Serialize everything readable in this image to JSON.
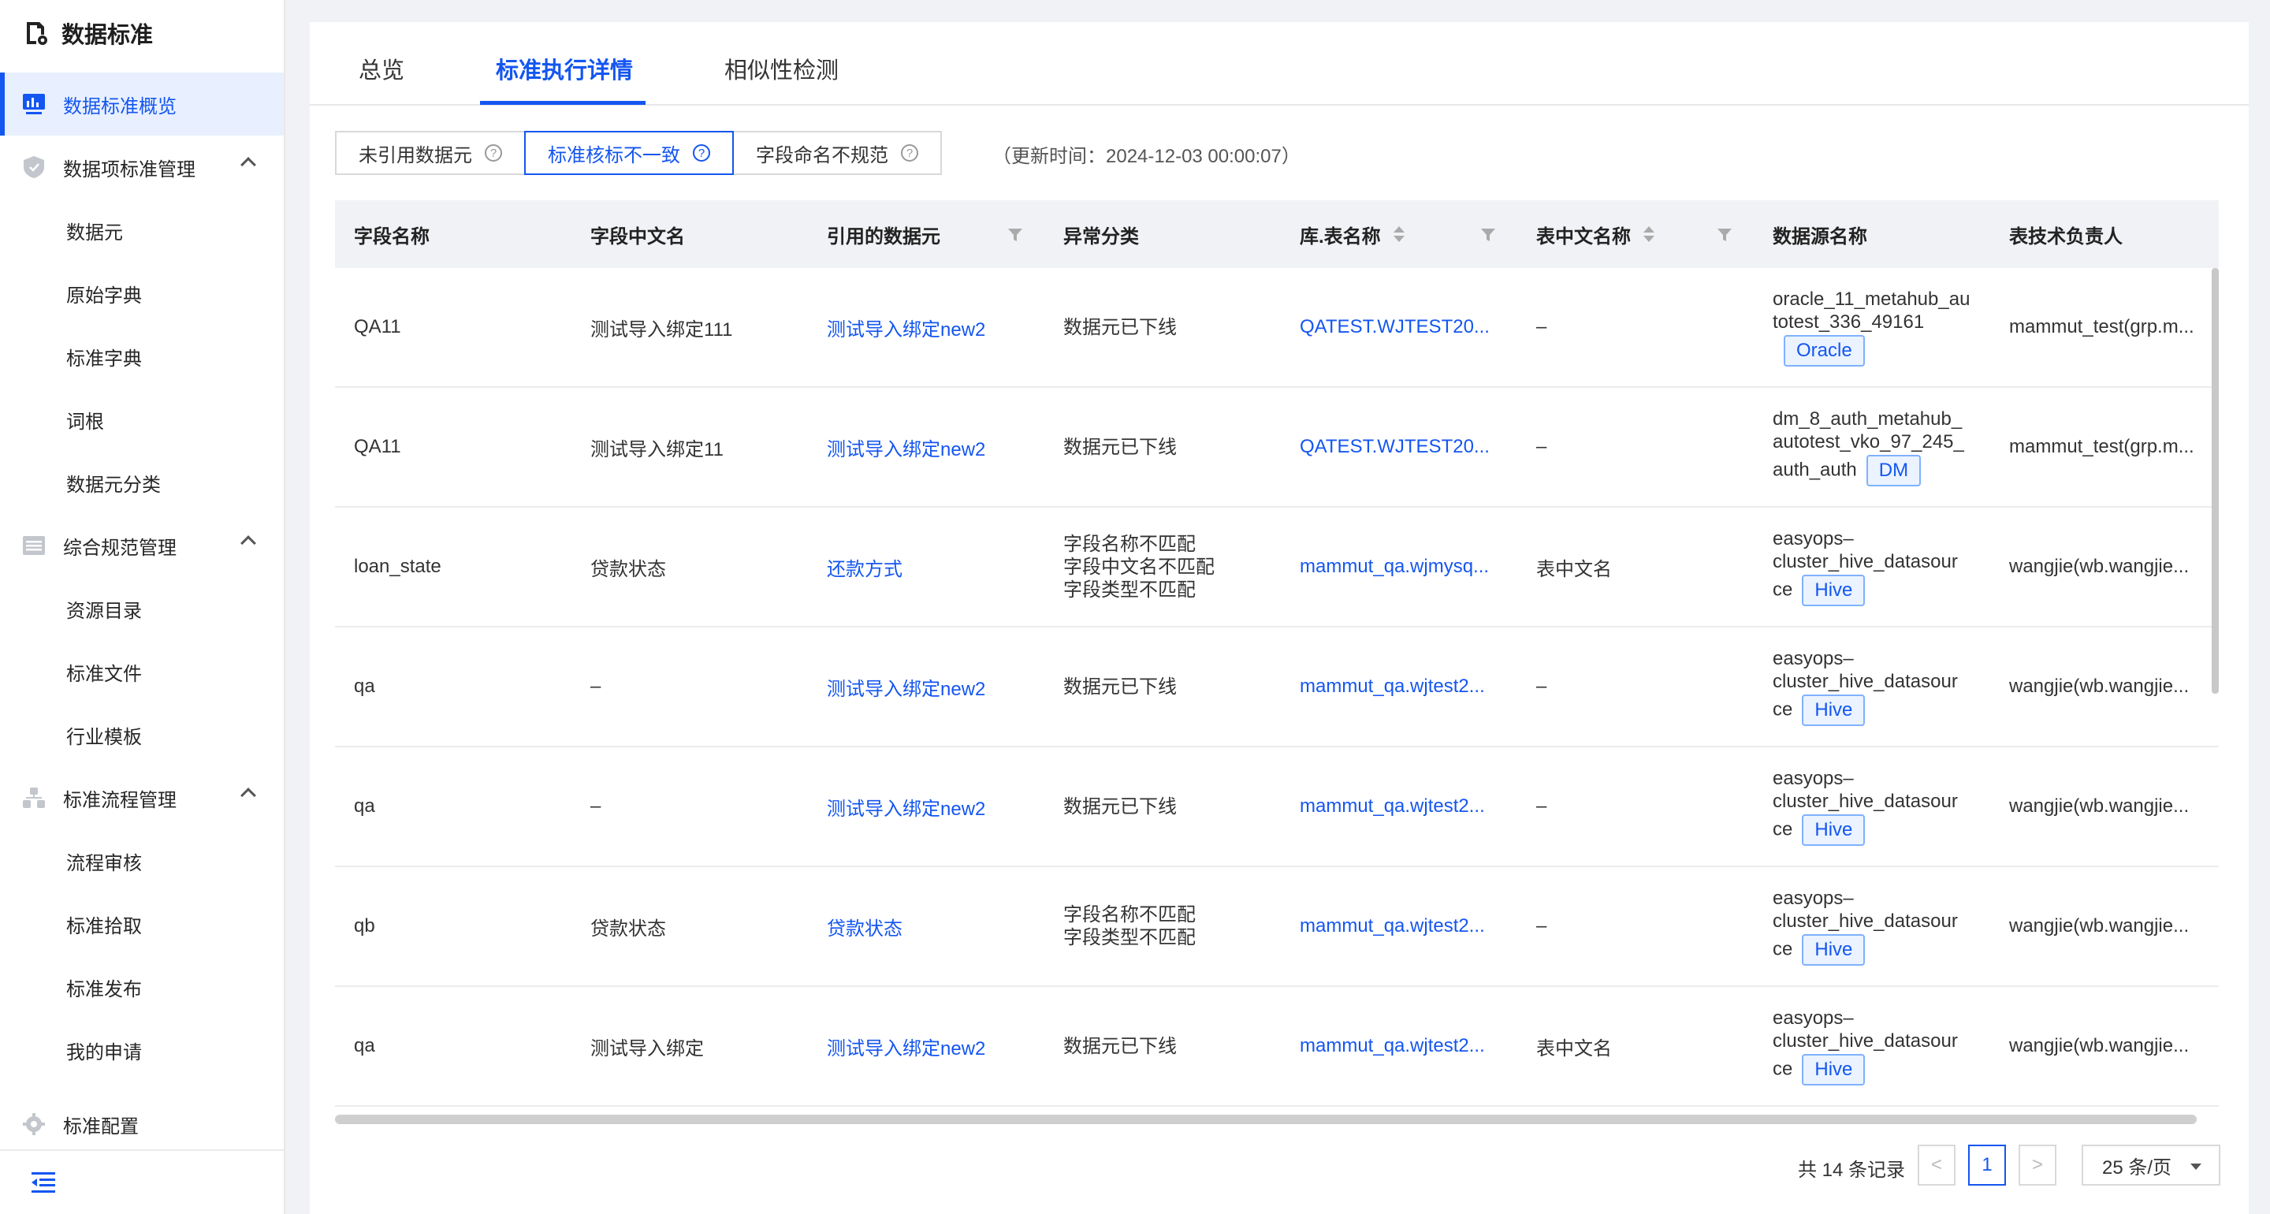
{
  "app": {
    "title": "数据标准"
  },
  "sidebar": {
    "items": [
      {
        "label": "数据标准概览",
        "type": "group",
        "active": true,
        "icon": "chart-icon"
      },
      {
        "label": "数据项标准管理",
        "type": "group",
        "icon": "shield-icon"
      },
      {
        "label": "数据元",
        "type": "sub"
      },
      {
        "label": "原始字典",
        "type": "sub"
      },
      {
        "label": "标准字典",
        "type": "sub"
      },
      {
        "label": "词根",
        "type": "sub"
      },
      {
        "label": "数据元分类",
        "type": "sub"
      },
      {
        "label": "综合规范管理",
        "type": "group",
        "icon": "list-icon"
      },
      {
        "label": "资源目录",
        "type": "sub"
      },
      {
        "label": "标准文件",
        "type": "sub"
      },
      {
        "label": "行业模板",
        "type": "sub"
      },
      {
        "label": "标准流程管理",
        "type": "group",
        "icon": "flow-icon"
      },
      {
        "label": "流程审核",
        "type": "sub"
      },
      {
        "label": "标准拾取",
        "type": "sub"
      },
      {
        "label": "标准发布",
        "type": "sub"
      },
      {
        "label": "我的申请",
        "type": "sub"
      },
      {
        "label": "标准配置",
        "type": "group",
        "icon": "gear-icon"
      }
    ]
  },
  "tabs": [
    "总览",
    "标准执行详情",
    "相似性检测"
  ],
  "filters": [
    "未引用数据元",
    "标准核标不一致",
    "字段命名不规范"
  ],
  "update_time": "（更新时间：2024-12-03 00:00:07）",
  "table": {
    "headers": [
      "字段名称",
      "字段中文名",
      "引用的数据元",
      "异常分类",
      "库.表名称",
      "表中文名称",
      "数据源名称",
      "表技术负责人"
    ],
    "rows": [
      {
        "field": "QA11",
        "cn": "测试导入绑定111",
        "ref": "测试导入绑定new2",
        "issues": [
          "数据元已下线"
        ],
        "table": "QATEST.WJTEST20...",
        "tcn": "–",
        "ds_lines": [
          "oracle_11_metahub_au",
          "totest_336_49161"
        ],
        "ds_last": "",
        "ds_tag": "Oracle",
        "owner": "mammut_test(grp.m..."
      },
      {
        "field": "QA11",
        "cn": "测试导入绑定11",
        "ref": "测试导入绑定new2",
        "issues": [
          "数据元已下线"
        ],
        "table": "QATEST.WJTEST20...",
        "tcn": "–",
        "ds_lines": [
          "dm_8_auth_metahub_",
          "autotest_vko_97_245_"
        ],
        "ds_last": "auth_auth",
        "ds_tag": "DM",
        "owner": "mammut_test(grp.m..."
      },
      {
        "field": "loan_state",
        "cn": "贷款状态",
        "ref": "还款方式",
        "issues": [
          "字段名称不匹配",
          "字段中文名不匹配",
          "字段类型不匹配"
        ],
        "table": "mammut_qa.wjmysq...",
        "tcn": "表中文名",
        "ds_lines": [
          "easyops–",
          "cluster_hive_datasour"
        ],
        "ds_last": "ce",
        "ds_tag": "Hive",
        "owner": "wangjie(wb.wangjie..."
      },
      {
        "field": "qa",
        "cn": "–",
        "ref": "测试导入绑定new2",
        "issues": [
          "数据元已下线"
        ],
        "table": "mammut_qa.wjtest2...",
        "tcn": "–",
        "ds_lines": [
          "easyops–",
          "cluster_hive_datasour"
        ],
        "ds_last": "ce",
        "ds_tag": "Hive",
        "owner": "wangjie(wb.wangjie..."
      },
      {
        "field": "qa",
        "cn": "–",
        "ref": "测试导入绑定new2",
        "issues": [
          "数据元已下线"
        ],
        "table": "mammut_qa.wjtest2...",
        "tcn": "–",
        "ds_lines": [
          "easyops–",
          "cluster_hive_datasour"
        ],
        "ds_last": "ce",
        "ds_tag": "Hive",
        "owner": "wangjie(wb.wangjie..."
      },
      {
        "field": "qb",
        "cn": "贷款状态",
        "ref": "贷款状态",
        "issues": [
          "字段名称不匹配",
          "字段类型不匹配"
        ],
        "table": "mammut_qa.wjtest2...",
        "tcn": "–",
        "ds_lines": [
          "easyops–",
          "cluster_hive_datasour"
        ],
        "ds_last": "ce",
        "ds_tag": "Hive",
        "owner": "wangjie(wb.wangjie..."
      },
      {
        "field": "qa",
        "cn": "测试导入绑定",
        "ref": "测试导入绑定new2",
        "issues": [
          "数据元已下线"
        ],
        "table": "mammut_qa.wjtest2...",
        "tcn": "表中文名",
        "ds_lines": [
          "easyops–",
          "cluster_hive_datasour"
        ],
        "ds_last": "ce",
        "ds_tag": "Hive",
        "owner": "wangjie(wb.wangjie..."
      }
    ]
  },
  "pagination": {
    "total": "共 14 条记录",
    "prev": "<",
    "current": "1",
    "next": ">",
    "page_size": "25 条/页"
  },
  "colors": {
    "accent": "#1456f0",
    "tag_bg": "#eaf3ff",
    "header_bg": "#f1f2f5"
  }
}
